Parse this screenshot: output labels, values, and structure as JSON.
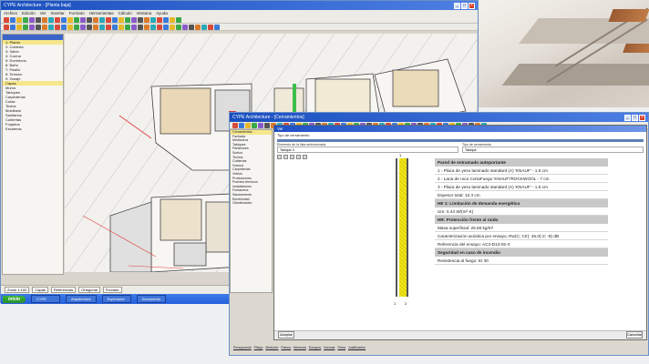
{
  "back_window": {
    "title": "CYPE Architecture - [Planta baja]",
    "menu": [
      "Archivo",
      "Edición",
      "Ver",
      "Insertar",
      "Formato",
      "Herramientas",
      "Cálculo",
      "Ventana",
      "Ayuda"
    ],
    "sidebar_rows": [
      "1: Planta",
      "2: Cubierta",
      "3: Salón",
      "4: Cocina",
      "5: Dormitorio",
      "6: Baño",
      "7: Pasillo",
      "8: Terraza",
      "9: Garaje",
      "Capas",
      "Muros",
      "Tabiques",
      "Carpinterías",
      "Cotas",
      "Textos",
      "Mobiliario",
      "Sanitarios",
      "Cubiertas",
      "Forjados",
      "Escaleras"
    ],
    "status": [
      "Zoom 1:100",
      "Capas",
      "Referencias",
      "Ortogonal",
      "Forzado"
    ],
    "taskbar": {
      "start": "inicio",
      "items": [
        "CYPE",
        "Arquitectura",
        "Explorador",
        "Documento"
      ]
    }
  },
  "front_window": {
    "title": "CYPE Architecture - [Cerramientos]",
    "sidebar_rows": [
      "Cerramientos",
      "Fachada",
      "Medianera",
      "Tabiques",
      "Particiones",
      "Suelos",
      "Techos",
      "Cubiertas",
      "Huecos",
      "Carpinterías",
      "Vidrios",
      "Protecciones",
      "Puentes térmicos",
      "Instalaciones",
      "Fontanería",
      "Saneamiento",
      "Electricidad",
      "Climatización"
    ],
    "bottom_links": [
      "Presupuesto",
      "Pliego",
      "Medición",
      "Planos",
      "Memoria",
      "Ensayos",
      "Normas",
      "Ficha",
      "Justificación"
    ],
    "dialog": {
      "header": "Ver",
      "section_label": "Tipo de cerramiento",
      "col1_label": "Elemento de la lista seleccionada",
      "col1_value": "Tabique 3",
      "col2_label": "Tipo de cerramiento",
      "col2_value": "Tabique",
      "top_mark": "1",
      "bottom_marks": [
        "1",
        "2"
      ],
      "table": [
        {
          "text": "Pared de entramado autoportante",
          "kind": "h"
        },
        {
          "text": "1 - Placa de yeso laminado standard (A) 'KNAUF' - 1.5 cm",
          "kind": "b"
        },
        {
          "text": "2 - Lana de roca CortaFuego 'KNAUF'/ROCKWOOL - 7 cm",
          "kind": "b"
        },
        {
          "text": "3 - Placa de yeso laminado standard (A) 'KNAUF' - 1.5 cm",
          "kind": "b"
        },
        {
          "text": "Espesor total: 10.3 cm",
          "kind": "b"
        },
        {
          "text": "HE 1: Limitación de demanda energética",
          "kind": "h"
        },
        {
          "text": "Um: 0.44 W/(m²·K)",
          "kind": "b"
        },
        {
          "text": "HR: Protección frente al ruido",
          "kind": "h"
        },
        {
          "text": "Masa superficial: 26.56 kg/m²",
          "kind": "b"
        },
        {
          "text": "Caracterización acústica por ensayo, Rw(C; Ctr): 46.0(-2; -8) dB",
          "kind": "b"
        },
        {
          "text": "Referencia del ensayo: AC3-D13-02-X",
          "kind": "b"
        },
        {
          "text": "Seguridad en caso de incendio",
          "kind": "h"
        },
        {
          "text": "Resistencia al fuego: EI 30",
          "kind": "b"
        }
      ],
      "buttons": {
        "left": "Aceptar",
        "right": "Cancelar"
      }
    }
  },
  "colors": {
    "title_blue": "#1a4fbf",
    "insulation": "#f1e51e",
    "taskbar": "#245edb",
    "start": "#3bb43b"
  }
}
